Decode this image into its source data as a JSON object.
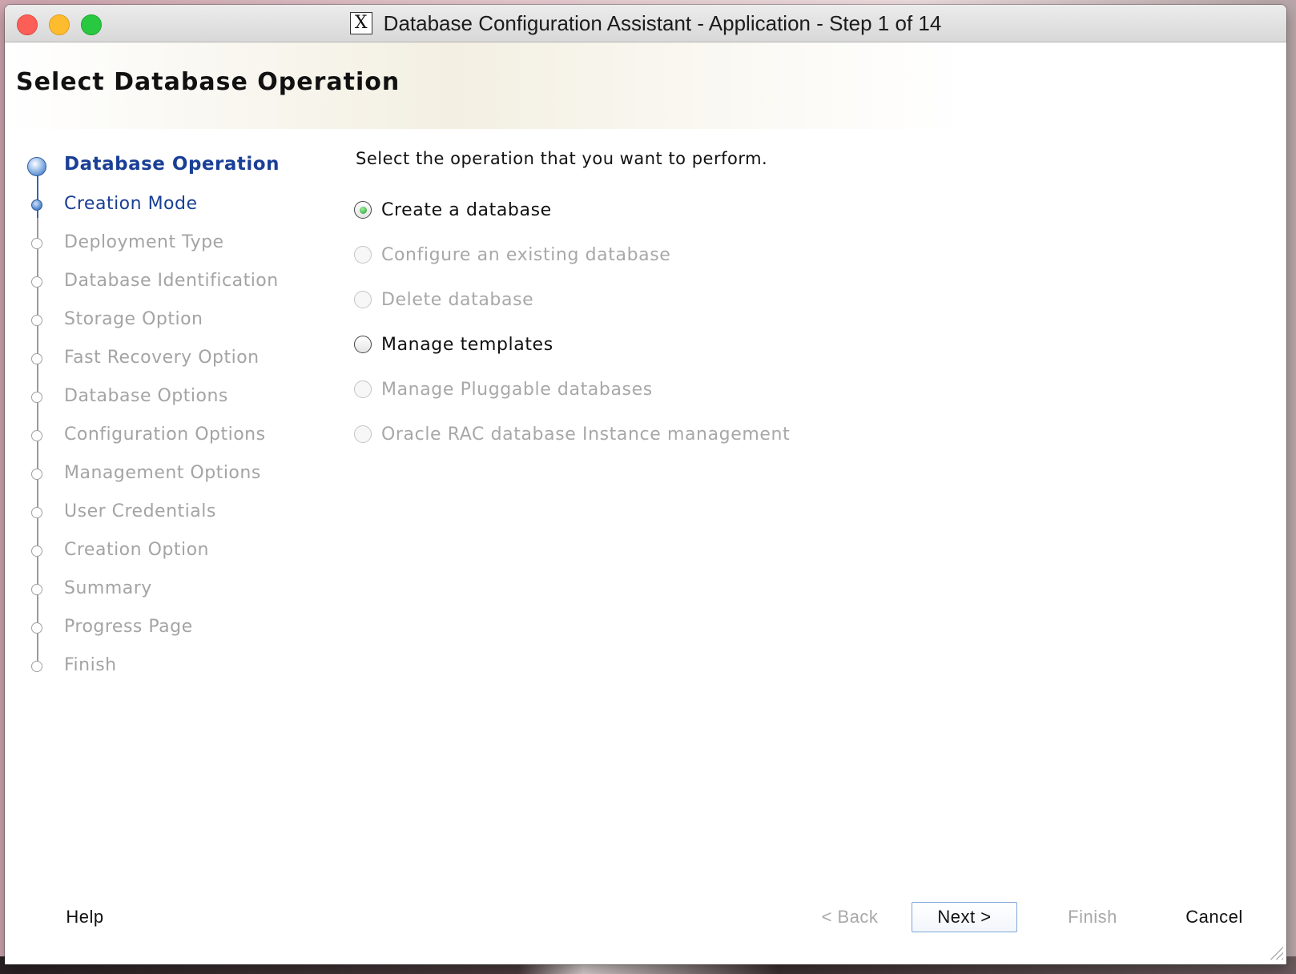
{
  "window": {
    "title": "Database Configuration Assistant - Application - Step 1 of 14",
    "app_icon": "X"
  },
  "header": {
    "title": "Select Database Operation"
  },
  "nav": {
    "items": [
      {
        "label": "Database Operation",
        "state": "current"
      },
      {
        "label": "Creation Mode",
        "state": "done"
      },
      {
        "label": "Deployment Type",
        "state": "pending"
      },
      {
        "label": "Database Identification",
        "state": "pending"
      },
      {
        "label": "Storage Option",
        "state": "pending"
      },
      {
        "label": "Fast Recovery Option",
        "state": "pending"
      },
      {
        "label": "Database Options",
        "state": "pending"
      },
      {
        "label": "Configuration Options",
        "state": "pending"
      },
      {
        "label": "Management Options",
        "state": "pending"
      },
      {
        "label": "User Credentials",
        "state": "pending"
      },
      {
        "label": "Creation Option",
        "state": "pending"
      },
      {
        "label": "Summary",
        "state": "pending"
      },
      {
        "label": "Progress Page",
        "state": "pending"
      },
      {
        "label": "Finish",
        "state": "pending"
      }
    ]
  },
  "main": {
    "prompt": "Select the operation that you want to perform.",
    "options": [
      {
        "label": "Create a database",
        "selected": true,
        "enabled": true
      },
      {
        "label": "Configure an existing database",
        "selected": false,
        "enabled": false
      },
      {
        "label": "Delete database",
        "selected": false,
        "enabled": false
      },
      {
        "label": "Manage templates",
        "selected": false,
        "enabled": true
      },
      {
        "label": "Manage Pluggable databases",
        "selected": false,
        "enabled": false
      },
      {
        "label": "Oracle RAC database Instance management",
        "selected": false,
        "enabled": false
      }
    ]
  },
  "footer": {
    "help": "Help",
    "back": "< Back",
    "next": "Next >",
    "finish": "Finish",
    "cancel": "Cancel"
  },
  "colors": {
    "nav_active": "#1a3f96",
    "disabled_text": "#a8a8a8",
    "radio_selected": "#1a9a2a"
  }
}
